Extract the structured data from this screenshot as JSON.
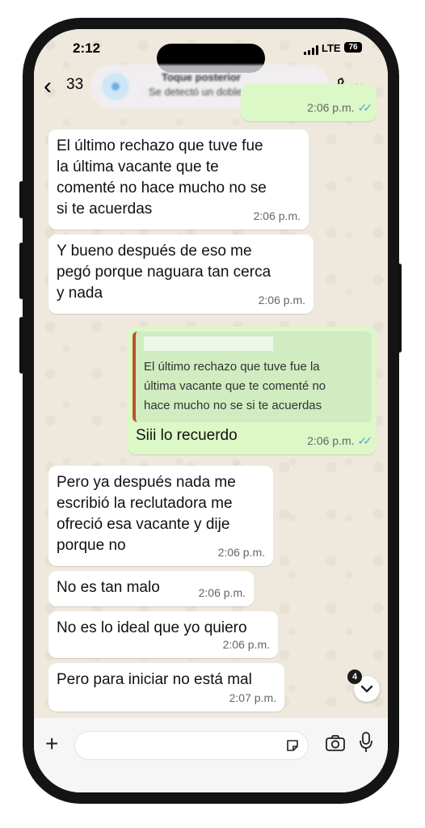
{
  "status_bar": {
    "time": "2:12",
    "network": "LTE",
    "battery": "76"
  },
  "header": {
    "back_count": "33"
  },
  "notification": {
    "title": "Toque posterior",
    "subtitle": "Se detectó un doble toque"
  },
  "messages": [
    {
      "direction": "out",
      "text": "",
      "time": "2:06 p.m.",
      "read": true
    },
    {
      "direction": "in",
      "text": "El último rechazo que tuve fue\nla última vacante que te\ncomenté no hace mucho no se\nsi te acuerdas",
      "time": "2:06 p.m."
    },
    {
      "direction": "in",
      "text": "Y bueno después de eso me\npegó porque naguara tan cerca\ny nada",
      "time": "2:06 p.m."
    },
    {
      "direction": "out",
      "quote": "El último rechazo que tuve fue la\núltima vacante que te comenté no\nhace mucho no se si te acuerdas",
      "text": "Siii lo recuerdo",
      "time": "2:06 p.m.",
      "read": true
    },
    {
      "direction": "in",
      "text": "Pero ya después nada me\nescribió la reclutadora me\nofreció esa vacante y dije\nporque no",
      "time": "2:06 p.m."
    },
    {
      "direction": "in",
      "text": "No es tan malo",
      "time": "2:06 p.m."
    },
    {
      "direction": "in",
      "text": "No es lo ideal que yo quiero",
      "time": "2:06 p.m."
    },
    {
      "direction": "in",
      "text": "Pero para iniciar no está mal",
      "time": "2:07 p.m."
    }
  ],
  "scroll_badge": "4",
  "colors": {
    "incoming": "#ffffff",
    "outgoing": "#dbf8c6",
    "tick": "#4fa6e0",
    "wallpaper": "#efe8dd"
  }
}
